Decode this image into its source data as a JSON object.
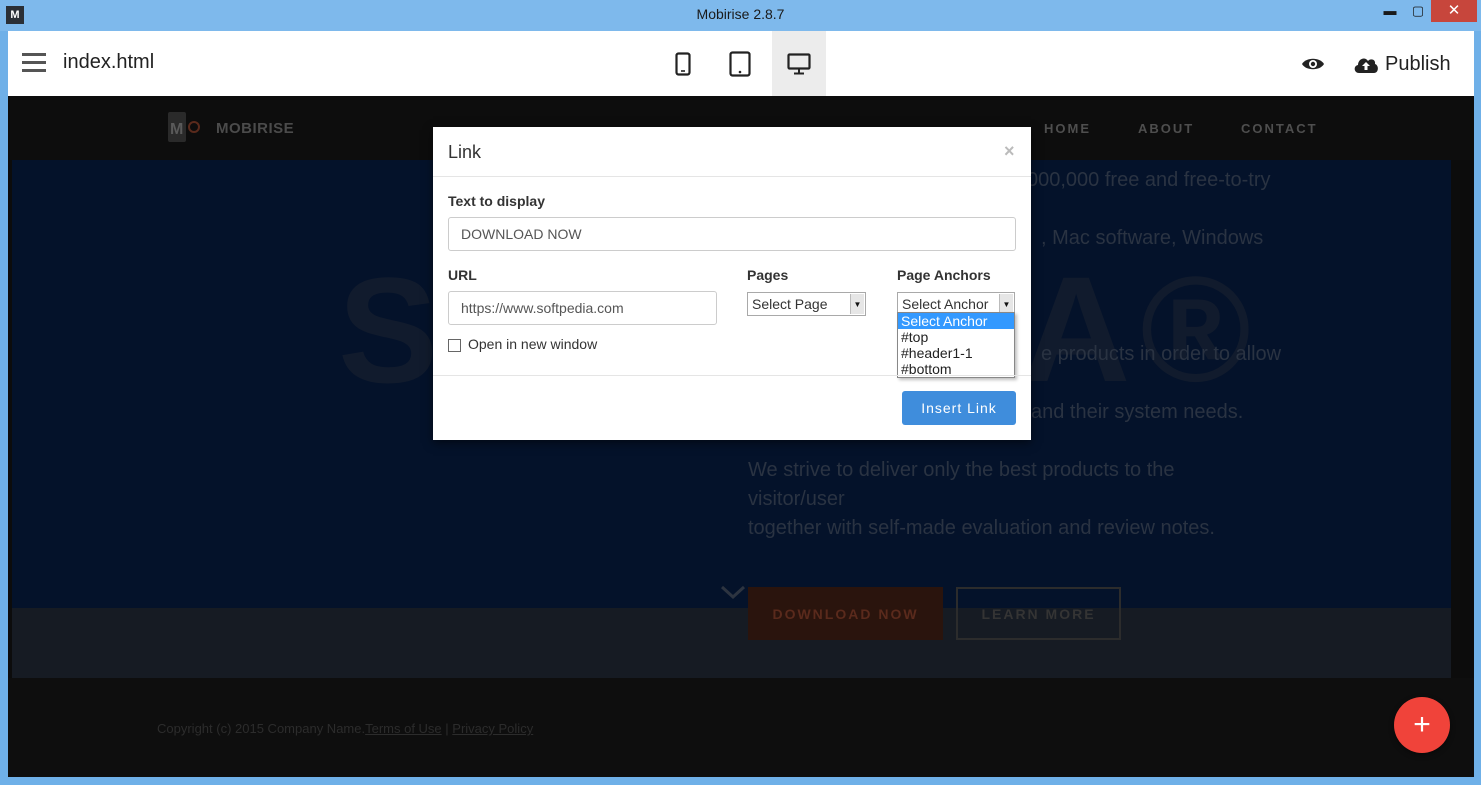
{
  "window": {
    "title": "Mobirise 2.8.7",
    "app_icon_glyph": "M",
    "minimize_glyph": "▬",
    "maximize_glyph": "▢",
    "close_glyph": "✕"
  },
  "toolbar": {
    "filename": "index.html",
    "devices": [
      "phone-icon",
      "tablet-icon",
      "desktop-icon"
    ],
    "active_device": "desktop",
    "preview_icon": "eye-icon",
    "publish_label": "Publish",
    "publish_icon": "cloud-upload-icon"
  },
  "site": {
    "logo_glyph": "M",
    "brand": "MOBIRISE",
    "nav": [
      "HOME",
      "ABOUT",
      "CONTACT"
    ],
    "hero_wordmark": "S",
    "hero_wordmark_tail": "A®",
    "hero_lines": [
      "000,000 free and free-to-try",
      ", Mac software, Windows",
      "e products in order to allow",
      "and their system needs.",
      "We strive to deliver only the best products to the",
      "visitor/user",
      "together with self-made evaluation and review notes."
    ],
    "download_label": "DOWNLOAD NOW",
    "learn_label": "LEARN MORE",
    "footer_prefix": "Copyright (c) 2015 Company Name.",
    "footer_terms": "Terms of Use",
    "footer_sep": " | ",
    "footer_privacy": "Privacy Policy",
    "fab_glyph": "+"
  },
  "modal": {
    "title": "Link",
    "close_glyph": "×",
    "text_label": "Text to display",
    "text_value": "DOWNLOAD NOW",
    "url_label": "URL",
    "url_value": "https://www.softpedia.com",
    "pages_label": "Pages",
    "pages_selected": "Select Page",
    "anchors_label": "Page Anchors",
    "anchors_selected": "Select Anchor",
    "anchor_options": [
      "Select Anchor",
      "#top",
      "#header1-1",
      "#bottom"
    ],
    "open_new_window_label": "Open in new window",
    "open_new_window_checked": false,
    "insert_label": "Insert Link"
  },
  "colors": {
    "window_titlebar": "#7eb9ec",
    "close_button": "#c7463c",
    "insert_button": "#3f8ddc",
    "fab": "#f0433a",
    "dropdown_highlight": "#3399ff"
  }
}
